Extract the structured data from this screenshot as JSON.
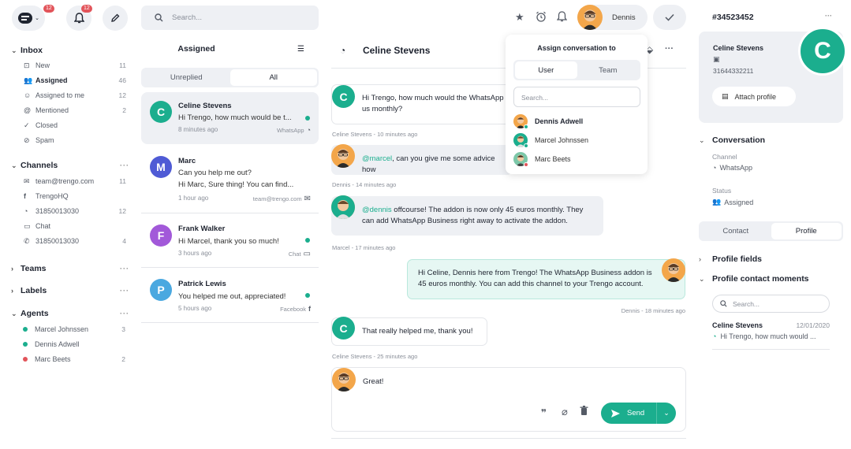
{
  "sidebar": {
    "logo_badge": "12",
    "bell_badge": "12",
    "inbox": {
      "title": "Inbox",
      "items": [
        {
          "label": "New",
          "count": "11",
          "icon": "inbox-icon"
        },
        {
          "label": "Assigned",
          "count": "46",
          "icon": "users-icon"
        },
        {
          "label": "Assigned to me",
          "count": "12",
          "icon": "user-icon"
        },
        {
          "label": "Mentioned",
          "count": "2",
          "icon": "at-icon"
        },
        {
          "label": "Closed",
          "count": "",
          "icon": "check-icon"
        },
        {
          "label": "Spam",
          "count": "",
          "icon": "spam-icon"
        }
      ]
    },
    "channels": {
      "title": "Channels",
      "items": [
        {
          "label": "team@trengo.com",
          "count": "11",
          "icon": "mail-icon"
        },
        {
          "label": "TrengoHQ",
          "count": "",
          "icon": "facebook-icon"
        },
        {
          "label": "31850013030",
          "count": "12",
          "icon": "whatsapp-icon"
        },
        {
          "label": "Chat",
          "count": "",
          "icon": "chat-icon"
        },
        {
          "label": "31850013030",
          "count": "4",
          "icon": "phone-icon"
        }
      ]
    },
    "teams_title": "Teams",
    "labels_title": "Labels",
    "agents": {
      "title": "Agents",
      "items": [
        {
          "label": "Marcel Johnssen",
          "count": "3",
          "color": "#1bae8e"
        },
        {
          "label": "Dennis Adwell",
          "count": "",
          "color": "#1bae8e"
        },
        {
          "label": "Marc Beets",
          "count": "2",
          "color": "#e2545a"
        }
      ]
    }
  },
  "list": {
    "search_placeholder": "Search...",
    "title": "Assigned",
    "tabs": [
      "Unreplied",
      "All"
    ],
    "conversations": [
      {
        "initial": "C",
        "name": "Celine Stevens",
        "preview": "Hi Trengo, how much would be t...",
        "time": "8 minutes ago",
        "source": "WhatsApp",
        "color": "#1bae8e"
      },
      {
        "initial": "M",
        "name": "Marc",
        "preview": "Can you help me out?",
        "preview2": "Hi Marc, Sure thing! You can find...",
        "time": "1 hour ago",
        "source": "team@trengo.com",
        "color": "#4f5bd5"
      },
      {
        "initial": "F",
        "name": "Frank Walker",
        "preview": "Hi Marcel, thank you so much!",
        "time": "3 hours ago",
        "source": "Chat",
        "color": "#a259d9"
      },
      {
        "initial": "P",
        "name": "Patrick Lewis",
        "preview": "You helped me out, appreciated!",
        "time": "5 hours ago",
        "source": "Facebook",
        "color": "#4aa8e0"
      }
    ]
  },
  "chat": {
    "title": "Celine Stevens",
    "messages": [
      {
        "line1": "Hi Trengo, how much would the WhatsApp",
        "line2": "us monthly?",
        "meta": "Celine Stevens - 10 minutes ago"
      },
      {
        "mention": "@marcel",
        "text": ", can you give me some advice how",
        "meta": "Dennis - 14 minutes ago"
      },
      {
        "mention": "@dennis",
        "text": " offcourse! The addon is now only 45 euros monthly. They",
        "line2": "can add WhatsApp Business right away to activate the addon.",
        "meta": "Marcel - 17 minutes ago"
      },
      {
        "line1": "Hi Celine, Dennis here from Trengo! The WhatsApp Business addon is",
        "line2": "45 euros monthly. You can add this channel to your Trengo account.",
        "meta": "Dennis - 18 minutes ago"
      },
      {
        "line1": "That really helped me, thank you!",
        "meta": "Celine Stevens - 25 minutes ago"
      }
    ],
    "composer_text": "Great!",
    "send_label": "Send"
  },
  "header": {
    "user_name": "Dennis"
  },
  "assign": {
    "title": "Assign conversation to",
    "tabs": [
      "User",
      "Team"
    ],
    "search_placeholder": "Search...",
    "agents": [
      {
        "name": "Dennis Adwell",
        "status_color": "#1bae8e"
      },
      {
        "name": "Marcel Johnssen",
        "status_color": "#1bae8e"
      },
      {
        "name": "Marc Beets",
        "status_color": "#e2545a"
      }
    ]
  },
  "profile": {
    "ticket_id": "#34523452",
    "name": "Celine Stevens",
    "phone": "31644332211",
    "initial": "C",
    "attach_label": "Attach profile",
    "conversation_title": "Conversation",
    "channel_label": "Channel",
    "channel_value": "WhatsApp",
    "status_label": "Status",
    "status_value": "Assigned",
    "tabs": [
      "Contact",
      "Profile"
    ],
    "profile_fields": "Profile fields",
    "contact_moments": "Profile contact moments",
    "search_placeholder": "Search...",
    "moment_name": "Celine Stevens",
    "moment_date": "12/01/2020",
    "moment_preview": "Hi Trengo, how much would ..."
  }
}
